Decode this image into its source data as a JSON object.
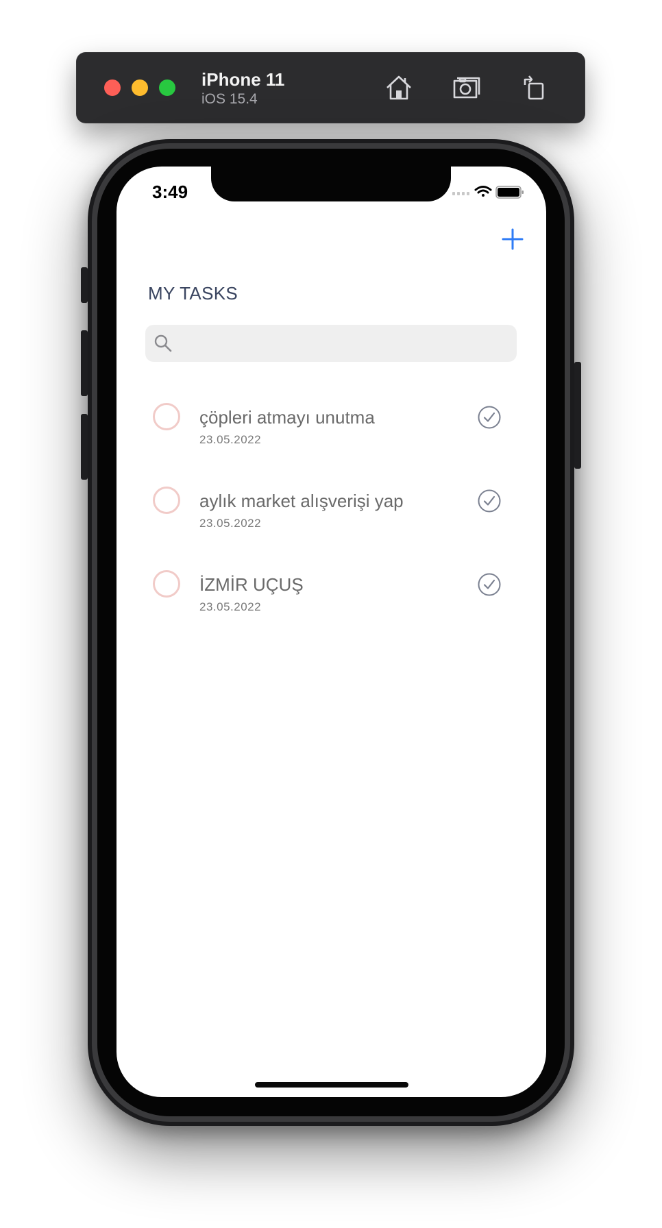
{
  "simulator": {
    "device_name": "iPhone 11",
    "os_version": "iOS 15.4",
    "icons": [
      "close-light",
      "minimize-light",
      "zoom-light",
      "home-icon",
      "screenshot-icon",
      "rotate-icon"
    ]
  },
  "status_bar": {
    "time": "3:49",
    "icons": [
      "cellular-icon",
      "wifi-icon",
      "battery-icon"
    ]
  },
  "header": {
    "add_icon": "plus-icon",
    "title": "MY TASKS"
  },
  "search": {
    "placeholder": "",
    "value": "",
    "icon": "search-icon"
  },
  "tasks": [
    {
      "title": "çöpleri atmayı unutma",
      "date": "23.05.2022"
    },
    {
      "title": "aylık market alışverişi yap",
      "date": "23.05.2022"
    },
    {
      "title": "İZMİR UÇUŞ",
      "date": "23.05.2022"
    }
  ],
  "colors": {
    "accent": "#2f7cf6",
    "task_circle": "#f1cbc8",
    "title": "#3a4560",
    "check": "#7a8090"
  }
}
